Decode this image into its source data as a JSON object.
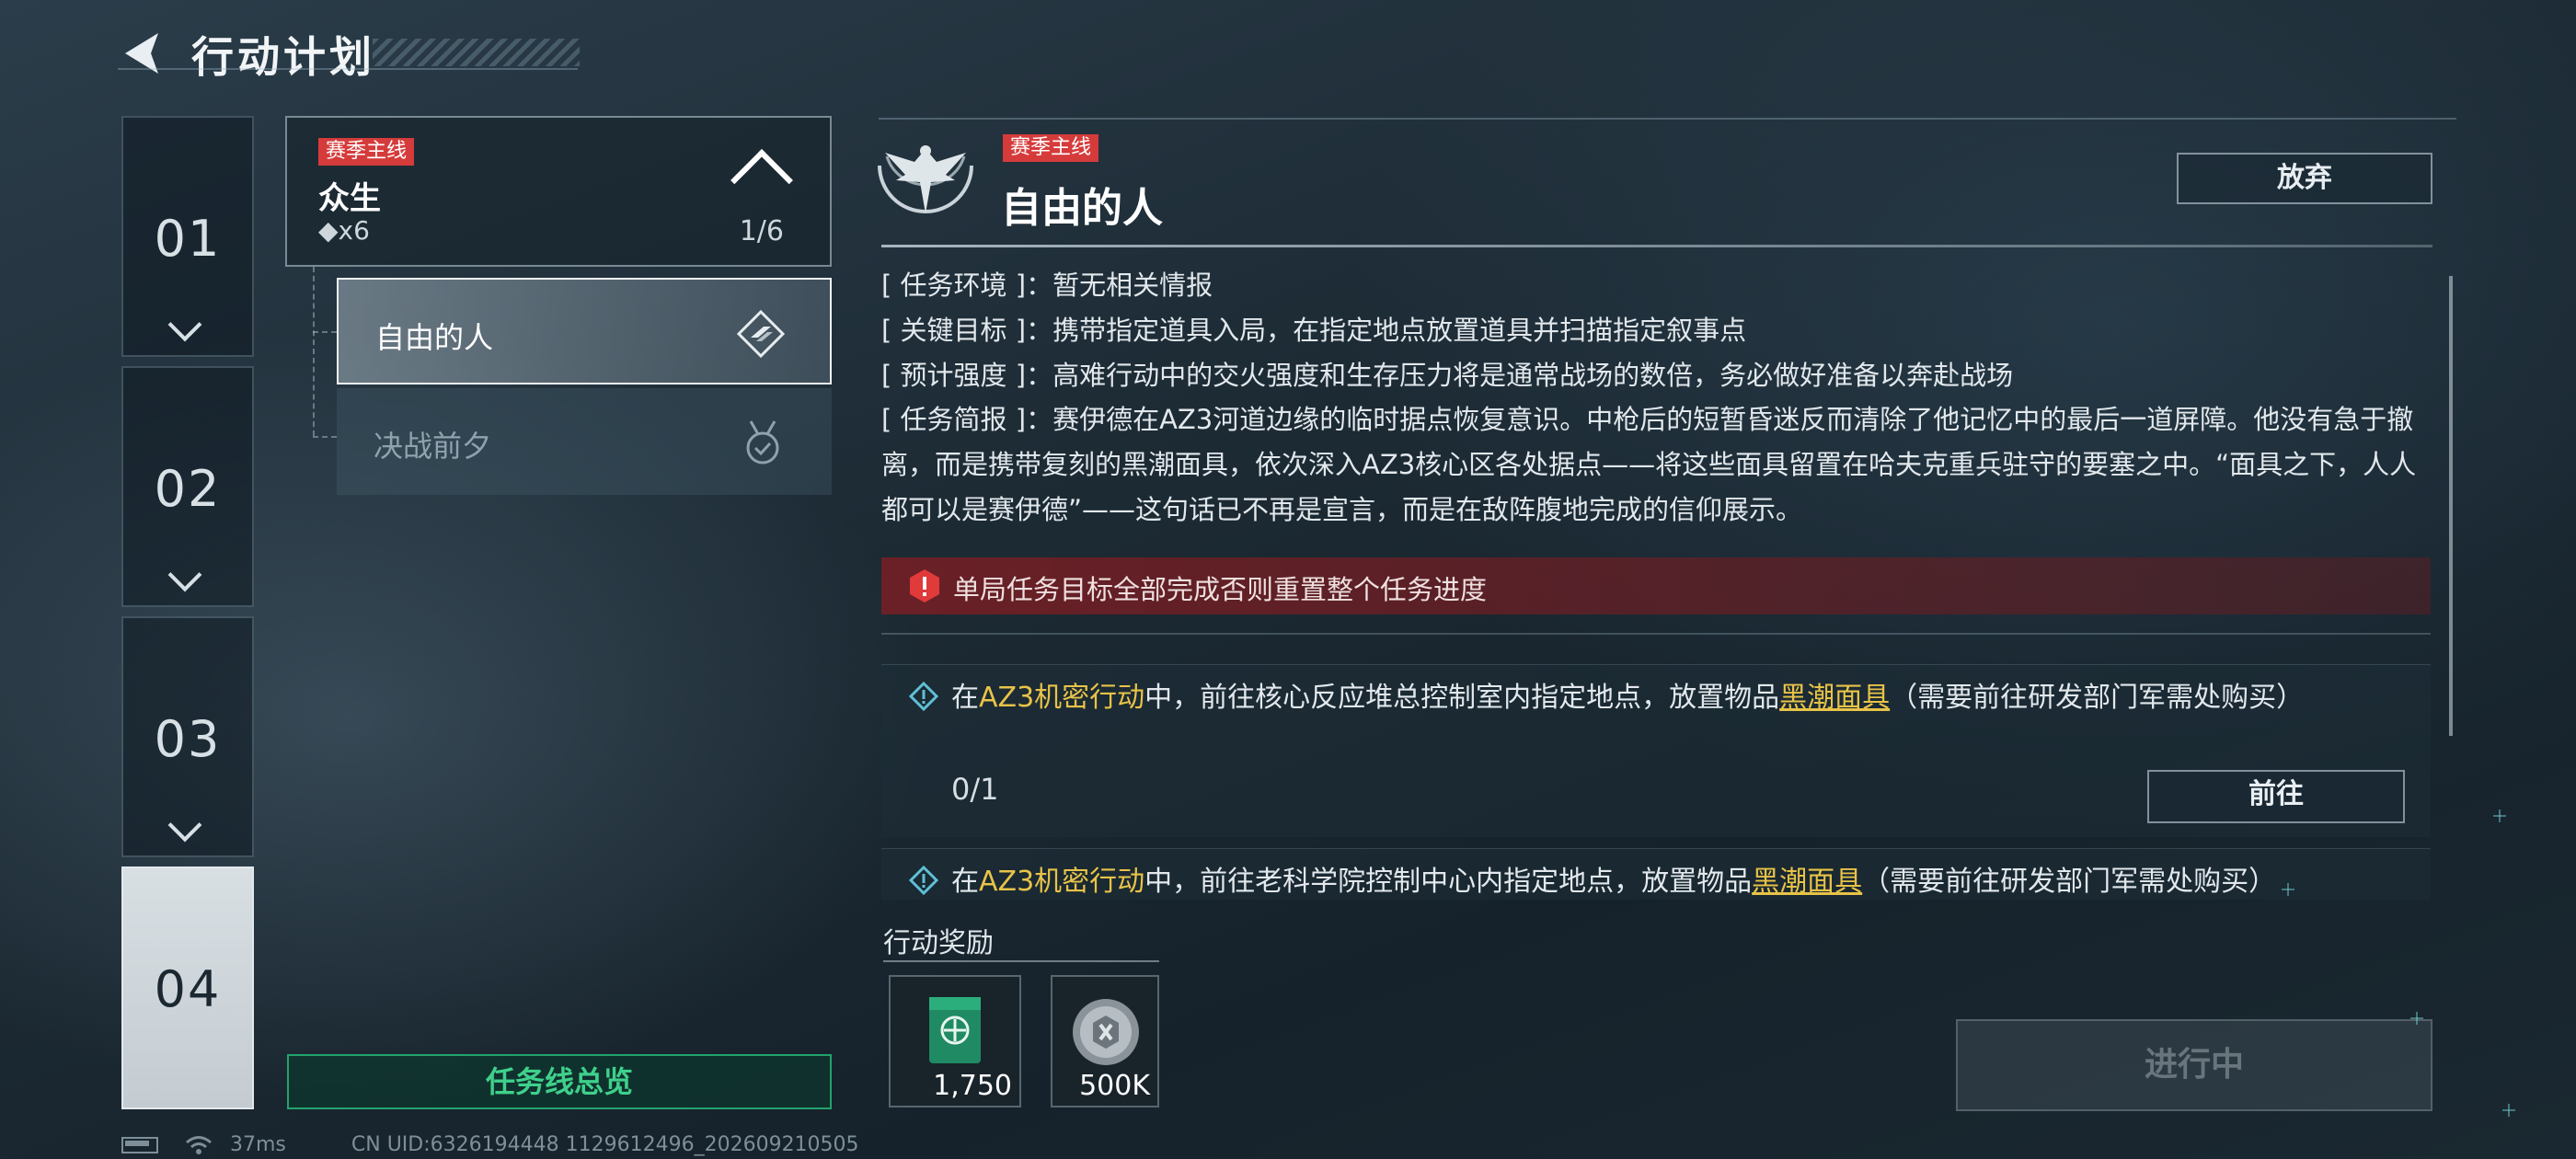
{
  "header": {
    "title": "行动计划"
  },
  "chapters": [
    {
      "num": "01",
      "active": false
    },
    {
      "num": "02",
      "active": false
    },
    {
      "num": "03",
      "active": false
    },
    {
      "num": "04",
      "active": true
    }
  ],
  "task_line": {
    "tag": "赛季主线",
    "name": "众生",
    "reward": "◆x6",
    "progress": "1/6",
    "missions": [
      {
        "label": "自由的人",
        "selected": true
      },
      {
        "label": "决战前夕",
        "selected": false
      }
    ],
    "overview_label": "任务线总览"
  },
  "detail": {
    "tag": "赛季主线",
    "title": "自由的人",
    "abandon_label": "放弃",
    "info": [
      {
        "key": "[ 任务环境 ]：",
        "value": "暂无相关情报"
      },
      {
        "key": "[ 关键目标 ]：",
        "value": "携带指定道具入局，在指定地点放置道具并扫描指定叙事点"
      },
      {
        "key": "[ 预计强度 ]：",
        "value": "高难行动中的交火强度和生存压力将是通常战场的数倍，务必做好准备以奔赴战场"
      }
    ],
    "brief_key": "[ 任务简报 ]：",
    "brief_text": "赛伊德在AZ3河道边缘的临时据点恢复意识。中枪后的短暂昏迷反而清除了他记忆中的最后一道屏障。他没有急于撤离，而是携带复刻的黑潮面具，依次深入AZ3核心区各处据点——将这些面具留置在哈夫克重兵驻守的要塞之中。“面具之下，人人都可以是赛伊德”——这句话已不再是宣言，而是在敌阵腹地完成的信仰展示。",
    "warning": "单局任务目标全部完成否则重置整个任务进度",
    "objectives": [
      {
        "pre": "在",
        "op": "AZ3机密行动",
        "mid": "中，前往核心反应堆总控制室内指定地点，放置物品",
        "item": "黑潮面具",
        "post": "（需要前往研发部门军需处购买）",
        "progress": "0/1",
        "goto_label": "前往"
      },
      {
        "pre": "在",
        "op": "AZ3机密行动",
        "mid": "中，前往老科学院控制中心内指定地点，放置物品",
        "item": "黑潮面具",
        "post": "（需要前往研发部门军需处购买）"
      }
    ],
    "reward_title": "行动奖励",
    "rewards": [
      {
        "icon": "green-supply-box-icon",
        "amount": "1,750"
      },
      {
        "icon": "silver-coin-icon",
        "amount": "500K"
      }
    ],
    "status_button": "进行中"
  },
  "status_bar": {
    "ping": "37ms",
    "uid": "CN UID:6326194448 1129612496_202609210505"
  },
  "colors": {
    "accent_green": "#3fd08b",
    "tag_red": "#d63b3b",
    "highlight_yellow": "#e8c347"
  }
}
